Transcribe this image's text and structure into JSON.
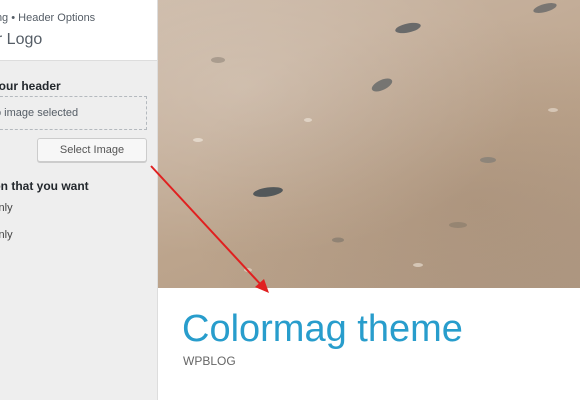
{
  "sidebar": {
    "breadcrumb": "zing • Header Options",
    "panel_title": "er Logo",
    "section_heading": "r your header",
    "placeholder_text": "o image selected",
    "select_button": "Select Image",
    "option_heading": "ion that you want",
    "radio_options": [
      "Only",
      "Only"
    ]
  },
  "preview": {
    "site_title": "Colormag theme",
    "site_description": "WPBLOG"
  },
  "colors": {
    "site_title": "#289dcc",
    "annotation_arrow": "#e02020",
    "sidebar_bg": "#eeeeee"
  },
  "icons": {
    "annotation": "red-arrow"
  }
}
